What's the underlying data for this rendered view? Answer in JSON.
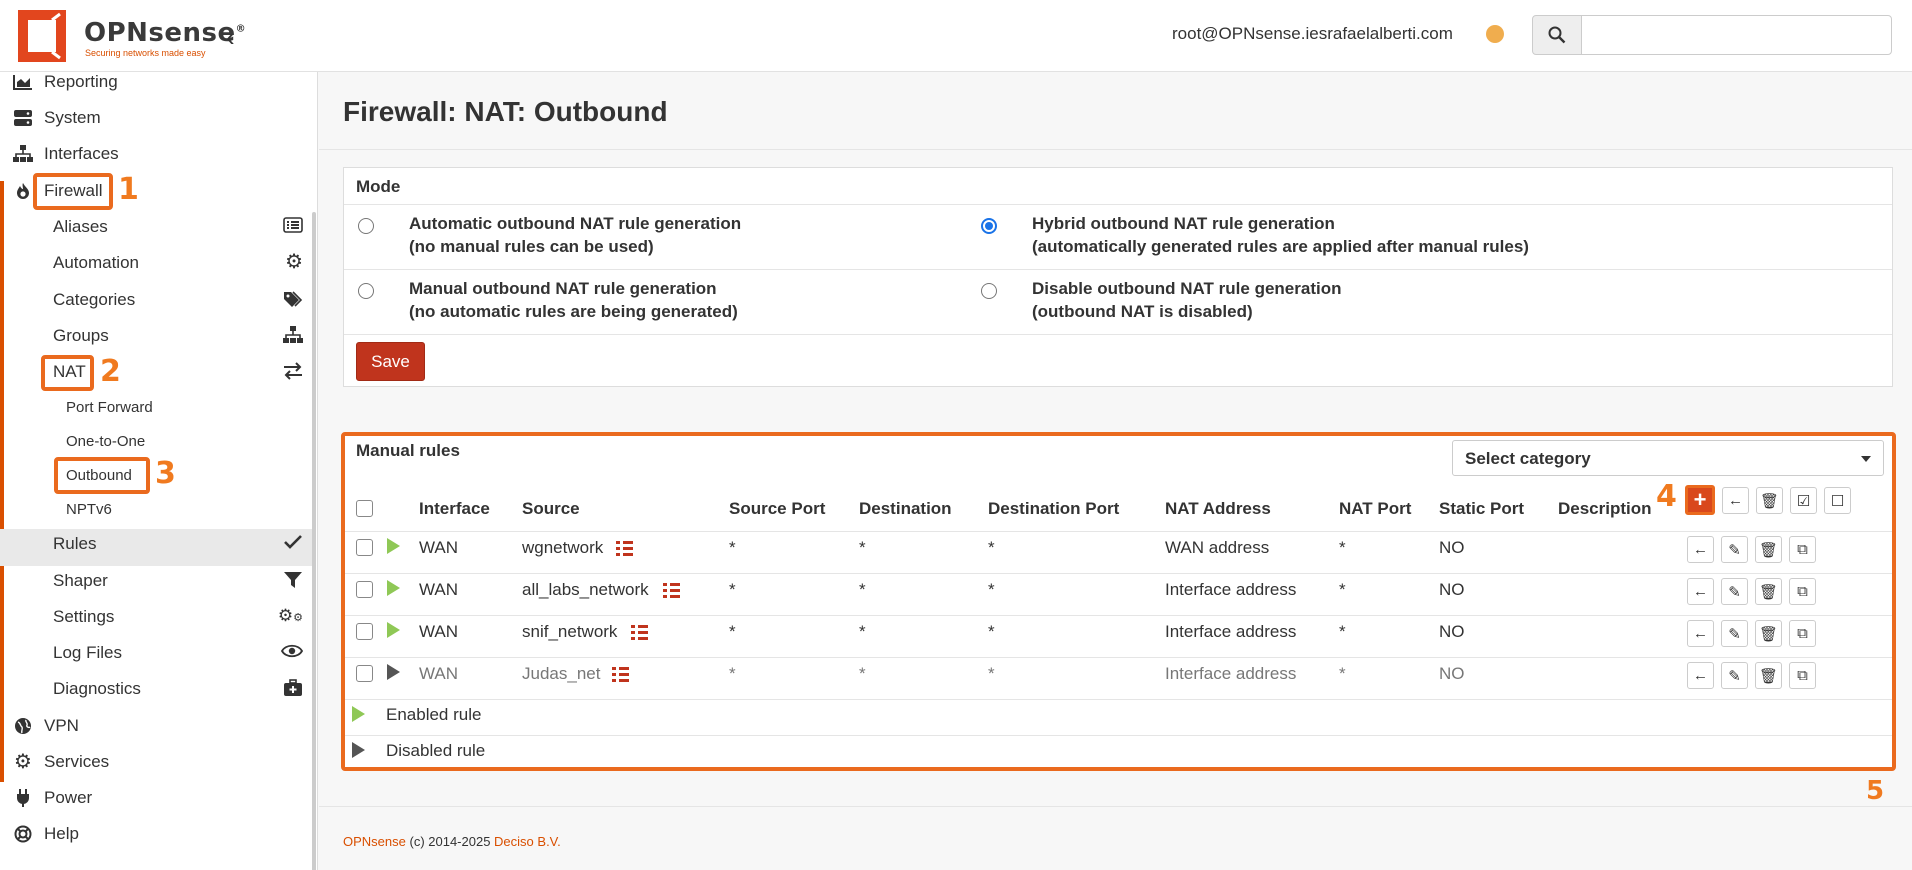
{
  "brand": {
    "name": "OPNsense",
    "tagline": "Securing networks made easy"
  },
  "header": {
    "user": "root@OPNsense.iesrafaelalberti.com",
    "status_color": "#f0ad4e"
  },
  "sidebar": {
    "top_items": [
      {
        "label": "Reporting",
        "icon": "chart-icon"
      },
      {
        "label": "System",
        "icon": "server-icon"
      },
      {
        "label": "Interfaces",
        "icon": "sitemap-icon"
      },
      {
        "label": "Firewall",
        "icon": "fire-icon"
      },
      {
        "label": "VPN",
        "icon": "globe-icon"
      },
      {
        "label": "Services",
        "icon": "gear-icon"
      },
      {
        "label": "Power",
        "icon": "plug-icon"
      },
      {
        "label": "Help",
        "icon": "lifebuoy-icon"
      }
    ],
    "firewall_items": [
      {
        "label": "Aliases",
        "icon": "list-icon"
      },
      {
        "label": "Automation",
        "icon": "gear-icon"
      },
      {
        "label": "Categories",
        "icon": "tags-icon"
      },
      {
        "label": "Groups",
        "icon": "sitemap-icon"
      },
      {
        "label": "NAT",
        "icon": "exchange-icon"
      },
      {
        "label": "Rules",
        "icon": "check-icon"
      },
      {
        "label": "Shaper",
        "icon": "filter-icon"
      },
      {
        "label": "Settings",
        "icon": "gears-icon"
      },
      {
        "label": "Log Files",
        "icon": "eye-icon"
      },
      {
        "label": "Diagnostics",
        "icon": "medkit-icon"
      }
    ],
    "nat_items": [
      {
        "label": "Port Forward"
      },
      {
        "label": "One-to-One"
      },
      {
        "label": "Outbound"
      },
      {
        "label": "NPTv6"
      }
    ]
  },
  "callouts": [
    "1",
    "2",
    "3",
    "4",
    "5"
  ],
  "page": {
    "title": "Firewall: NAT: Outbound"
  },
  "mode": {
    "heading": "Mode",
    "options": [
      {
        "line1": "Automatic outbound NAT rule generation",
        "line2": "(no manual rules can be used)",
        "selected": false
      },
      {
        "line1": "Hybrid outbound NAT rule generation",
        "line2": "(automatically generated rules are applied after manual rules)",
        "selected": true
      },
      {
        "line1": "Manual outbound NAT rule generation",
        "line2": "(no automatic rules are being generated)",
        "selected": false
      },
      {
        "line1": "Disable outbound NAT rule generation",
        "line2": "(outbound NAT is disabled)",
        "selected": false
      }
    ],
    "save_label": "Save"
  },
  "rules": {
    "heading": "Manual rules",
    "category_placeholder": "Select category",
    "columns": [
      "Interface",
      "Source",
      "Source Port",
      "Destination",
      "Destination Port",
      "NAT Address",
      "NAT Port",
      "Static Port",
      "Description"
    ],
    "rows": [
      {
        "enabled": true,
        "interface": "WAN",
        "source": "wgnetwork",
        "source_port": "*",
        "destination": "*",
        "destination_port": "*",
        "nat_address": "WAN address",
        "nat_port": "*",
        "static_port": "NO"
      },
      {
        "enabled": true,
        "interface": "WAN",
        "source": "all_labs_network",
        "source_port": "*",
        "destination": "*",
        "destination_port": "*",
        "nat_address": "Interface address",
        "nat_port": "*",
        "static_port": "NO"
      },
      {
        "enabled": true,
        "interface": "WAN",
        "source": "snif_network",
        "source_port": "*",
        "destination": "*",
        "destination_port": "*",
        "nat_address": "Interface address",
        "nat_port": "*",
        "static_port": "NO"
      },
      {
        "enabled": false,
        "interface": "WAN",
        "source": "Judas_net",
        "source_port": "*",
        "destination": "*",
        "destination_port": "*",
        "nat_address": "Interface address",
        "nat_port": "*",
        "static_port": "NO"
      }
    ],
    "legend": {
      "enabled": "Enabled rule",
      "disabled": "Disabled rule"
    }
  },
  "footer": {
    "brand": "OPNsense",
    "copyright": " (c) 2014-2025 ",
    "company": "Deciso B.V."
  },
  "colors": {
    "accent": "#d94f00",
    "save": "#c0341d",
    "enabled": "#8fc856",
    "callout": "#ea6a1e"
  }
}
